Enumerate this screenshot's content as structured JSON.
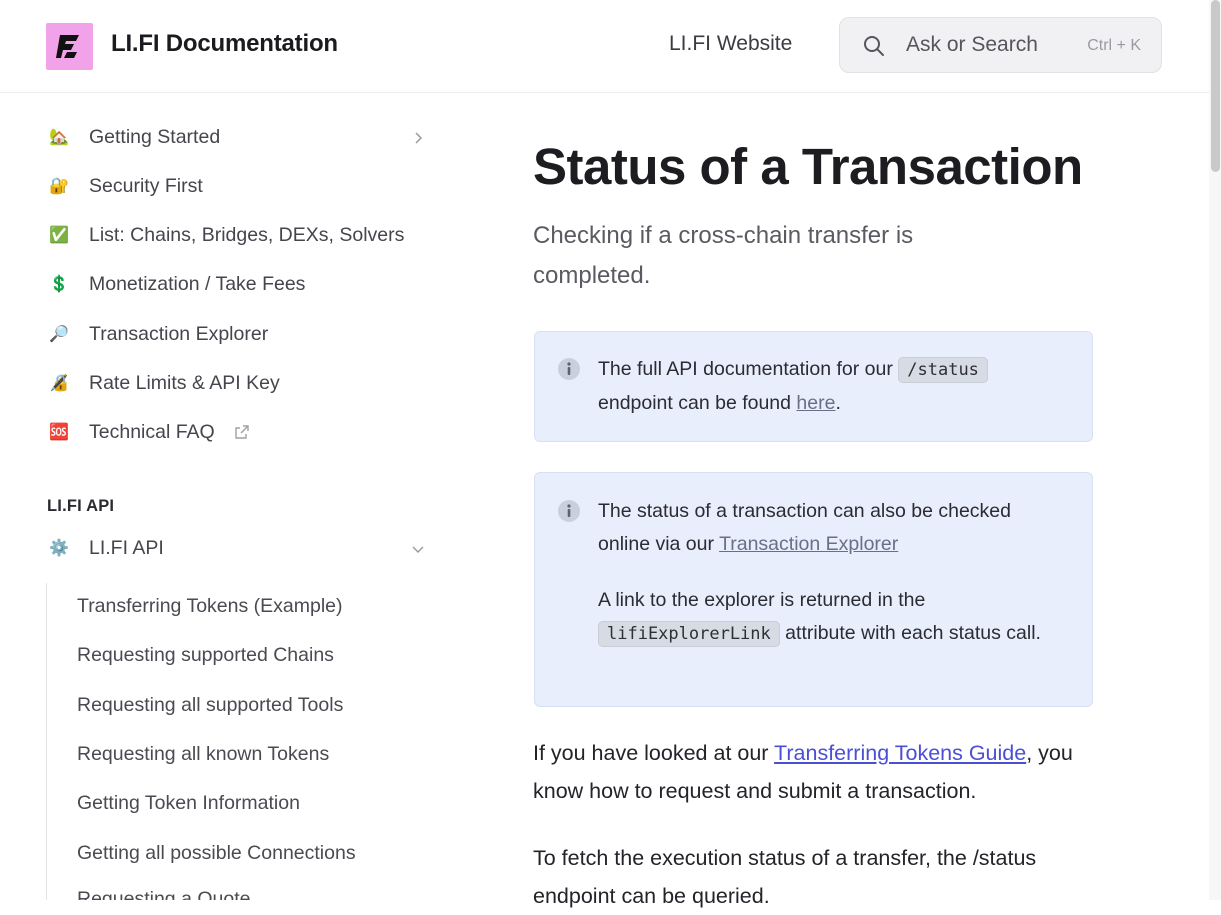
{
  "header": {
    "title": "LI.FI Documentation",
    "website_link": "LI.FI Website",
    "search_placeholder": "Ask or Search",
    "search_shortcut": "Ctrl + K"
  },
  "sidebar": {
    "items": [
      {
        "emoji": "🏡",
        "label": "Getting Started"
      },
      {
        "emoji": "🔐",
        "label": "Security First"
      },
      {
        "emoji": "✅",
        "label": "List: Chains, Bridges, DEXs, Solvers"
      },
      {
        "emoji": "💲",
        "label": "Monetization / Take Fees"
      },
      {
        "emoji": "🔎",
        "label": "Transaction Explorer"
      },
      {
        "emoji": "🔏",
        "label": "Rate Limits & API Key"
      },
      {
        "emoji": "🆘",
        "label": "Technical FAQ"
      }
    ],
    "section_heading": "LI.FI API",
    "api_group": {
      "emoji": "⚙️",
      "label": "LI.FI API"
    },
    "sub_items": [
      "Transferring Tokens (Example)",
      "Requesting supported Chains",
      "Requesting all supported Tools",
      "Requesting all known Tokens",
      "Getting Token Information",
      "Getting all possible Connections",
      "Requesting a Quote"
    ]
  },
  "main": {
    "title": "Status of a Transaction",
    "subtitle": "Checking if a cross-chain transfer is completed.",
    "hint1": {
      "pre": "The full API documentation for our ",
      "code": "/status",
      "mid": " endpoint can be found ",
      "link": "here",
      "post": "."
    },
    "hint2": {
      "line1_pre": "The status of a transaction can also be checked online via our ",
      "line1_link": "Transaction Explorer",
      "line2_pre": "A link to the explorer is returned in the ",
      "line2_code": "lifiExplorerLink",
      "line2_post": " attribute with each status call."
    },
    "para1": {
      "pre": "If you have looked at our ",
      "link": "Transferring Tokens Guide",
      "post": ", you know how to request and submit a transaction."
    },
    "para2": "To fetch the execution status of a transfer, the /status endpoint can be queried."
  },
  "colors": {
    "logo_bg": "#f2a2e8",
    "hint_bg": "#e8eefb",
    "link": "#4b4fd6"
  }
}
